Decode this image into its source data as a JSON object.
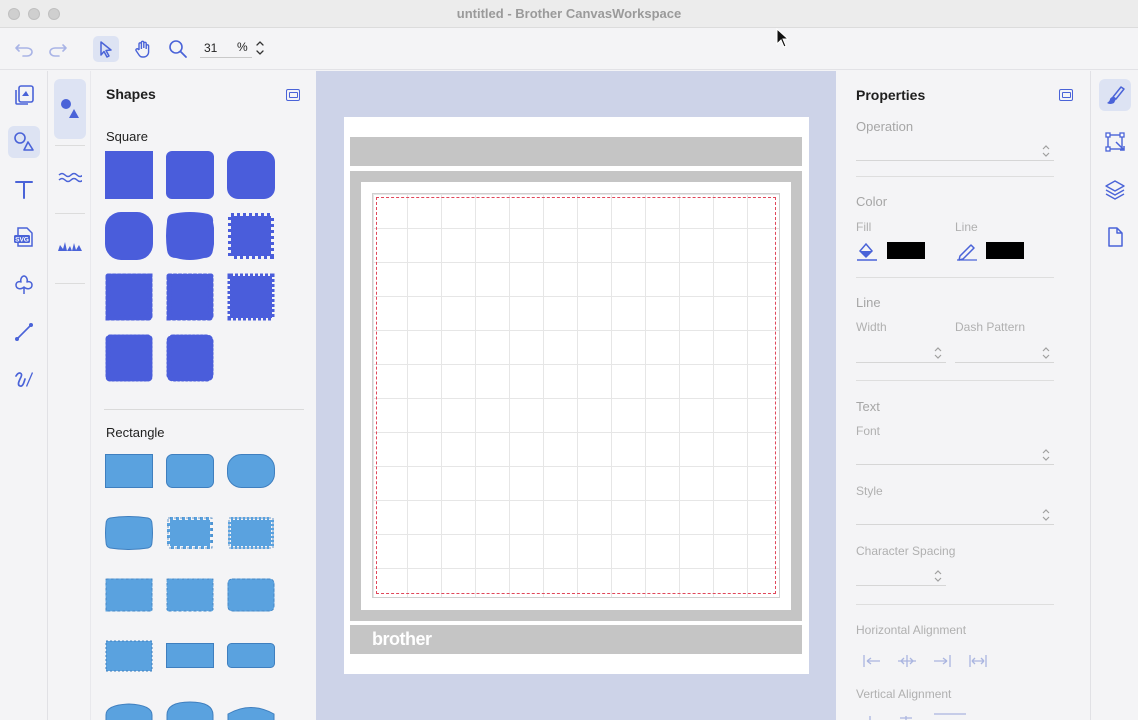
{
  "window": {
    "title": "untitled - Brother CanvasWorkspace"
  },
  "toolbar": {
    "zoom_value": "31",
    "zoom_unit": "%"
  },
  "shapes_panel": {
    "title": "Shapes",
    "sections": [
      {
        "label": "Square"
      },
      {
        "label": "Rectangle"
      }
    ]
  },
  "canvas": {
    "brand_text": "brother"
  },
  "properties": {
    "title": "Properties",
    "operation_label": "Operation",
    "color_label": "Color",
    "fill_label": "Fill",
    "line_label": "Line",
    "line_section_label": "Line",
    "width_label": "Width",
    "dash_pattern_label": "Dash Pattern",
    "text_section_label": "Text",
    "font_label": "Font",
    "style_label": "Style",
    "char_spacing_label": "Character Spacing",
    "h_align_label": "Horizontal Alignment",
    "v_align_label": "Vertical Alignment",
    "fill_color": "#000000",
    "line_color": "#000000"
  },
  "colors": {
    "accent": "#4a63d8",
    "square_fill": "#4a5ddb",
    "rect_fill": "#5aa2df",
    "active_bg": "#dde3f3",
    "canvas_bg": "#cdd3e8",
    "mat_gray": "#c5c5c5",
    "cut_line": "#e1475a"
  }
}
